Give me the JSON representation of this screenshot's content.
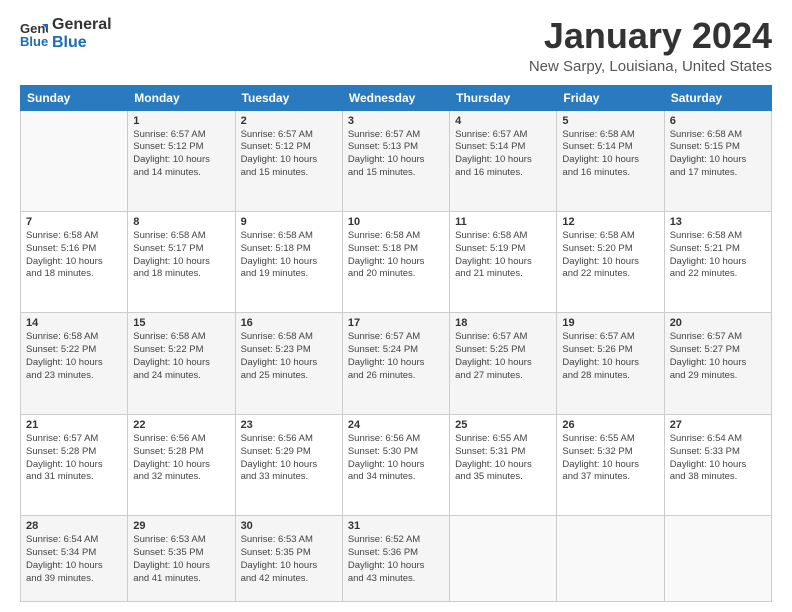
{
  "logo": {
    "line1": "General",
    "line2": "Blue"
  },
  "title": "January 2024",
  "location": "New Sarpy, Louisiana, United States",
  "weekdays": [
    "Sunday",
    "Monday",
    "Tuesday",
    "Wednesday",
    "Thursday",
    "Friday",
    "Saturday"
  ],
  "weeks": [
    [
      {
        "num": "",
        "info": ""
      },
      {
        "num": "1",
        "info": "Sunrise: 6:57 AM\nSunset: 5:12 PM\nDaylight: 10 hours\nand 14 minutes."
      },
      {
        "num": "2",
        "info": "Sunrise: 6:57 AM\nSunset: 5:12 PM\nDaylight: 10 hours\nand 15 minutes."
      },
      {
        "num": "3",
        "info": "Sunrise: 6:57 AM\nSunset: 5:13 PM\nDaylight: 10 hours\nand 15 minutes."
      },
      {
        "num": "4",
        "info": "Sunrise: 6:57 AM\nSunset: 5:14 PM\nDaylight: 10 hours\nand 16 minutes."
      },
      {
        "num": "5",
        "info": "Sunrise: 6:58 AM\nSunset: 5:14 PM\nDaylight: 10 hours\nand 16 minutes."
      },
      {
        "num": "6",
        "info": "Sunrise: 6:58 AM\nSunset: 5:15 PM\nDaylight: 10 hours\nand 17 minutes."
      }
    ],
    [
      {
        "num": "7",
        "info": "Sunrise: 6:58 AM\nSunset: 5:16 PM\nDaylight: 10 hours\nand 18 minutes."
      },
      {
        "num": "8",
        "info": "Sunrise: 6:58 AM\nSunset: 5:17 PM\nDaylight: 10 hours\nand 18 minutes."
      },
      {
        "num": "9",
        "info": "Sunrise: 6:58 AM\nSunset: 5:18 PM\nDaylight: 10 hours\nand 19 minutes."
      },
      {
        "num": "10",
        "info": "Sunrise: 6:58 AM\nSunset: 5:18 PM\nDaylight: 10 hours\nand 20 minutes."
      },
      {
        "num": "11",
        "info": "Sunrise: 6:58 AM\nSunset: 5:19 PM\nDaylight: 10 hours\nand 21 minutes."
      },
      {
        "num": "12",
        "info": "Sunrise: 6:58 AM\nSunset: 5:20 PM\nDaylight: 10 hours\nand 22 minutes."
      },
      {
        "num": "13",
        "info": "Sunrise: 6:58 AM\nSunset: 5:21 PM\nDaylight: 10 hours\nand 22 minutes."
      }
    ],
    [
      {
        "num": "14",
        "info": "Sunrise: 6:58 AM\nSunset: 5:22 PM\nDaylight: 10 hours\nand 23 minutes."
      },
      {
        "num": "15",
        "info": "Sunrise: 6:58 AM\nSunset: 5:22 PM\nDaylight: 10 hours\nand 24 minutes."
      },
      {
        "num": "16",
        "info": "Sunrise: 6:58 AM\nSunset: 5:23 PM\nDaylight: 10 hours\nand 25 minutes."
      },
      {
        "num": "17",
        "info": "Sunrise: 6:57 AM\nSunset: 5:24 PM\nDaylight: 10 hours\nand 26 minutes."
      },
      {
        "num": "18",
        "info": "Sunrise: 6:57 AM\nSunset: 5:25 PM\nDaylight: 10 hours\nand 27 minutes."
      },
      {
        "num": "19",
        "info": "Sunrise: 6:57 AM\nSunset: 5:26 PM\nDaylight: 10 hours\nand 28 minutes."
      },
      {
        "num": "20",
        "info": "Sunrise: 6:57 AM\nSunset: 5:27 PM\nDaylight: 10 hours\nand 29 minutes."
      }
    ],
    [
      {
        "num": "21",
        "info": "Sunrise: 6:57 AM\nSunset: 5:28 PM\nDaylight: 10 hours\nand 31 minutes."
      },
      {
        "num": "22",
        "info": "Sunrise: 6:56 AM\nSunset: 5:28 PM\nDaylight: 10 hours\nand 32 minutes."
      },
      {
        "num": "23",
        "info": "Sunrise: 6:56 AM\nSunset: 5:29 PM\nDaylight: 10 hours\nand 33 minutes."
      },
      {
        "num": "24",
        "info": "Sunrise: 6:56 AM\nSunset: 5:30 PM\nDaylight: 10 hours\nand 34 minutes."
      },
      {
        "num": "25",
        "info": "Sunrise: 6:55 AM\nSunset: 5:31 PM\nDaylight: 10 hours\nand 35 minutes."
      },
      {
        "num": "26",
        "info": "Sunrise: 6:55 AM\nSunset: 5:32 PM\nDaylight: 10 hours\nand 37 minutes."
      },
      {
        "num": "27",
        "info": "Sunrise: 6:54 AM\nSunset: 5:33 PM\nDaylight: 10 hours\nand 38 minutes."
      }
    ],
    [
      {
        "num": "28",
        "info": "Sunrise: 6:54 AM\nSunset: 5:34 PM\nDaylight: 10 hours\nand 39 minutes."
      },
      {
        "num": "29",
        "info": "Sunrise: 6:53 AM\nSunset: 5:35 PM\nDaylight: 10 hours\nand 41 minutes."
      },
      {
        "num": "30",
        "info": "Sunrise: 6:53 AM\nSunset: 5:35 PM\nDaylight: 10 hours\nand 42 minutes."
      },
      {
        "num": "31",
        "info": "Sunrise: 6:52 AM\nSunset: 5:36 PM\nDaylight: 10 hours\nand 43 minutes."
      },
      {
        "num": "",
        "info": ""
      },
      {
        "num": "",
        "info": ""
      },
      {
        "num": "",
        "info": ""
      }
    ]
  ]
}
